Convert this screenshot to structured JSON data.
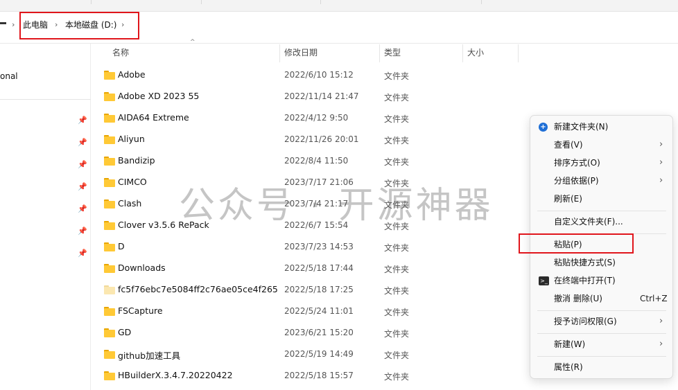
{
  "breadcrumb": {
    "items": [
      "此电脑",
      "本地磁盘 (D:)"
    ]
  },
  "sidebar": {
    "partial_label": "onal"
  },
  "columns": {
    "name": "名称",
    "date": "修改日期",
    "type": "类型",
    "size": "大小"
  },
  "files": [
    {
      "name": "Adobe",
      "date": "2022/6/10 15:12",
      "type": "文件夹"
    },
    {
      "name": "Adobe XD 2023 55",
      "date": "2022/11/14 21:47",
      "type": "文件夹"
    },
    {
      "name": "AIDA64 Extreme",
      "date": "2022/4/12 9:50",
      "type": "文件夹"
    },
    {
      "name": "Aliyun",
      "date": "2022/11/26 20:01",
      "type": "文件夹"
    },
    {
      "name": "Bandizip",
      "date": "2022/8/4 11:50",
      "type": "文件夹"
    },
    {
      "name": "CIMCO",
      "date": "2023/7/17 21:06",
      "type": "文件夹"
    },
    {
      "name": "Clash",
      "date": "2023/7/4 21:17",
      "type": "文件夹"
    },
    {
      "name": "Clover v3.5.6 RePack",
      "date": "2022/6/7 15:54",
      "type": "文件夹"
    },
    {
      "name": "D",
      "date": "2023/7/23 14:53",
      "type": "文件夹"
    },
    {
      "name": "Downloads",
      "date": "2022/5/18 17:44",
      "type": "文件夹"
    },
    {
      "name": "fc5f76ebc7e5084ff2c76ae05ce4f265",
      "date": "2022/5/18 17:25",
      "type": "文件夹"
    },
    {
      "name": "FSCapture",
      "date": "2022/5/24 11:01",
      "type": "文件夹"
    },
    {
      "name": "GD",
      "date": "2023/6/21 15:20",
      "type": "文件夹"
    },
    {
      "name": "github加速工具",
      "date": "2022/5/19 14:49",
      "type": "文件夹"
    },
    {
      "name": "HBuilderX.3.4.7.20220422",
      "date": "2022/5/18 15:57",
      "type": "文件夹"
    }
  ],
  "watermark": "公众号 · 开源神器",
  "context_menu": {
    "new_folder": "新建文件夹(N)",
    "view": "查看(V)",
    "sort": "排序方式(O)",
    "group": "分组依据(P)",
    "refresh": "刷新(E)",
    "customize": "自定义文件夹(F)...",
    "paste": "粘贴(P)",
    "paste_shortcut": "粘贴快捷方式(S)",
    "open_terminal": "在终端中打开(T)",
    "undo_delete": "撤消 删除(U)",
    "undo_shortcut": "Ctrl+Z",
    "grant_access": "授予访问权限(G)",
    "new": "新建(W)",
    "properties": "属性(R)"
  },
  "colors": {
    "highlight_box": "#e0151b",
    "folder": "#ffc936",
    "accent": "#1f6fd6"
  }
}
